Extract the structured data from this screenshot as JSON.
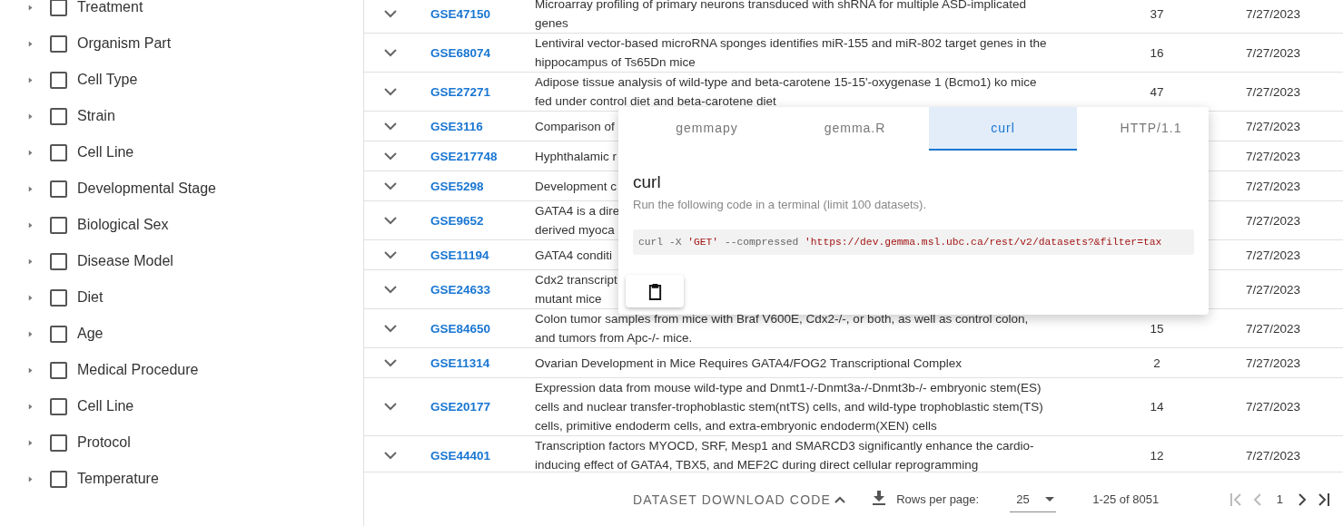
{
  "sidebar": {
    "filters": [
      {
        "label": "Treatment",
        "expanded": false,
        "checked": false
      },
      {
        "label": "Organism Part",
        "expanded": false,
        "checked": false
      },
      {
        "label": "Cell Type",
        "expanded": false,
        "checked": false
      },
      {
        "label": "Strain",
        "expanded": false,
        "checked": false
      },
      {
        "label": "Cell Line",
        "expanded": false,
        "checked": false
      },
      {
        "label": "Developmental Stage",
        "expanded": false,
        "checked": false
      },
      {
        "label": "Biological Sex",
        "expanded": false,
        "checked": false
      },
      {
        "label": "Disease Model",
        "expanded": false,
        "checked": false
      },
      {
        "label": "Diet",
        "expanded": false,
        "checked": false
      },
      {
        "label": "Age",
        "expanded": false,
        "checked": false
      },
      {
        "label": "Medical Procedure",
        "expanded": false,
        "checked": false
      },
      {
        "label": "Cell Line",
        "expanded": false,
        "checked": false
      },
      {
        "label": "Protocol",
        "expanded": false,
        "checked": false
      },
      {
        "label": "Temperature",
        "expanded": false,
        "checked": false
      }
    ]
  },
  "table": {
    "rows": [
      {
        "expanded": false,
        "accession": "GSE47150",
        "title_lines": [
          "Microarray profiling of primary neurons transduced with shRNA for multiple ASD-implicated",
          "genes"
        ],
        "count": "37",
        "date": "7/27/2023"
      },
      {
        "expanded": false,
        "accession": "GSE68074",
        "title_lines": [
          "Lentiviral vector-based microRNA sponges identifies miR-155 and miR-802 target genes in the",
          "hippocampus of Ts65Dn mice"
        ],
        "count": "16",
        "date": "7/27/2023"
      },
      {
        "expanded": false,
        "accession": "GSE27271",
        "title_lines": [
          "Adipose tissue analysis of wild-type and beta-carotene 15-15'-oxygenase 1 (Bcmo1) ko mice",
          "fed under control diet and beta-carotene diet"
        ],
        "count": "47",
        "date": "7/27/2023"
      },
      {
        "expanded": false,
        "accession": "GSE3116",
        "title_lines": [
          "Comparison of"
        ],
        "date": "7/27/2023"
      },
      {
        "expanded": false,
        "accession": "GSE217748",
        "title_lines": [
          "Hyphthalamic r"
        ],
        "date": "7/27/2023"
      },
      {
        "expanded": false,
        "accession": "GSE5298",
        "title_lines": [
          "Development c"
        ],
        "date": "7/27/2023"
      },
      {
        "expanded": false,
        "accession": "GSE9652",
        "title_lines": [
          "GATA4 is a dire",
          "derived myoca"
        ],
        "date": "7/27/2023"
      },
      {
        "expanded": false,
        "accession": "GSE11194",
        "title_lines": [
          "GATA4 conditi"
        ],
        "date": "7/27/2023"
      },
      {
        "expanded": false,
        "accession": "GSE24633",
        "title_lines": [
          "Cdx2 transcript",
          "mutant mice"
        ],
        "date": "7/27/2023"
      },
      {
        "expanded": false,
        "accession": "GSE84650",
        "title_lines": [
          "Colon tumor samples from mice with Braf V600E, Cdx2-/-, or both, as well as control colon,",
          "and tumors from Apc-/- mice."
        ],
        "count": "15",
        "date": "7/27/2023"
      },
      {
        "expanded": false,
        "accession": "GSE11314",
        "title_lines": [
          "Ovarian Development in Mice Requires GATA4/FOG2 Transcriptional Complex"
        ],
        "count": "2",
        "date": "7/27/2023"
      },
      {
        "expanded": false,
        "accession": "GSE20177",
        "title_lines": [
          "Expression data from mouse wild-type and Dnmt1-/-Dnmt3a-/-Dnmt3b-/- embryonic stem(ES)",
          "cells and nuclear transfer-trophoblastic stem(ntTS) cells, and wild-type trophoblastic stem(TS)",
          "cells, primitive endoderm cells, and extra-embryonic endoderm(XEN) cells"
        ],
        "count": "14",
        "date": "7/27/2023"
      },
      {
        "expanded": false,
        "accession": "GSE44401",
        "title_lines": [
          "Transcription factors MYOCD, SRF, Mesp1 and SMARCD3 significantly enhance the cardio-",
          "inducing effect of GATA4, TBX5, and MEF2C during direct cellular reprogramming"
        ],
        "count": "12",
        "date": "7/27/2023"
      }
    ]
  },
  "code_popup": {
    "tabs": [
      {
        "label": "gemmapy",
        "selected": false
      },
      {
        "label": "gemma.R",
        "selected": false
      },
      {
        "label": "curl",
        "selected": true
      },
      {
        "label": "HTTP/1.1",
        "selected": false
      }
    ],
    "heading": "curl",
    "description": "Run the following code in a terminal (limit 100 datasets).",
    "code": [
      {
        "kind": "plain",
        "text": "curl -X "
      },
      {
        "kind": "string",
        "text": "'GET'"
      },
      {
        "kind": "plain",
        "text": " --compressed "
      },
      {
        "kind": "string",
        "text": "'https://dev.gemma.msl.ubc.ca/rest/v2/datasets?&filter=tax"
      }
    ]
  },
  "footer": {
    "download_toggle": {
      "label": "DATASET DOWNLOAD CODE",
      "expanded": true
    },
    "rows_per_page_label": "Rows per page:",
    "rows_per_page": "25",
    "range": "1-25 of 8051",
    "page": "1",
    "first_disabled": true,
    "prev_disabled": true,
    "next_disabled": false,
    "last_disabled": false
  }
}
